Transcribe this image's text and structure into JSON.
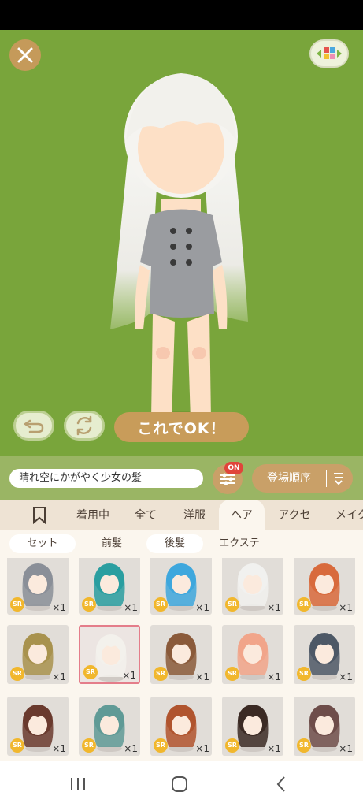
{
  "stage": {
    "ok_button": "これでOK！",
    "bg_color": "#79a53b"
  },
  "search": {
    "value": "晴れ空にかがやく少女の髪"
  },
  "filter": {
    "badge": "ON"
  },
  "sort": {
    "label": "登場順序"
  },
  "tabs": [
    {
      "label": "着用中"
    },
    {
      "label": "全て"
    },
    {
      "label": "洋服"
    },
    {
      "label": "ヘア"
    },
    {
      "label": "アクセ"
    },
    {
      "label": "メイク"
    }
  ],
  "subtabs": [
    {
      "label": "セット"
    },
    {
      "label": "前髪"
    },
    {
      "label": "後髪"
    },
    {
      "label": "エクステ"
    }
  ],
  "items": [
    {
      "rarity": "SR",
      "count": "×1",
      "hair": "#8a8f98"
    },
    {
      "rarity": "SR",
      "count": "×1",
      "hair": "#2a9ea0"
    },
    {
      "rarity": "SR",
      "count": "×1",
      "hair": "#3ea7dd"
    },
    {
      "rarity": "SR",
      "count": "×1",
      "hair": "#f1f1ef"
    },
    {
      "rarity": "SR",
      "count": "×1",
      "hair": "#d86a3c"
    },
    {
      "rarity": "SR",
      "count": "×1",
      "hair": "#a8924e"
    },
    {
      "rarity": "SR",
      "count": "×1",
      "hair": "#f3f1ec"
    },
    {
      "rarity": "SR",
      "count": "×1",
      "hair": "#8a5a3a"
    },
    {
      "rarity": "SR",
      "count": "×1",
      "hair": "#f1a58a"
    },
    {
      "rarity": "SR",
      "count": "×1",
      "hair": "#4d5866"
    },
    {
      "rarity": "SR",
      "count": "×1",
      "hair": "#6a3a2e"
    },
    {
      "rarity": "SR",
      "count": "×1",
      "hair": "#5f9a96"
    },
    {
      "rarity": "SR",
      "count": "×1",
      "hair": "#b0542e"
    },
    {
      "rarity": "SR",
      "count": "×1",
      "hair": "#3b2a24"
    },
    {
      "rarity": "SR",
      "count": "×1",
      "hair": "#6e4d4a"
    }
  ]
}
